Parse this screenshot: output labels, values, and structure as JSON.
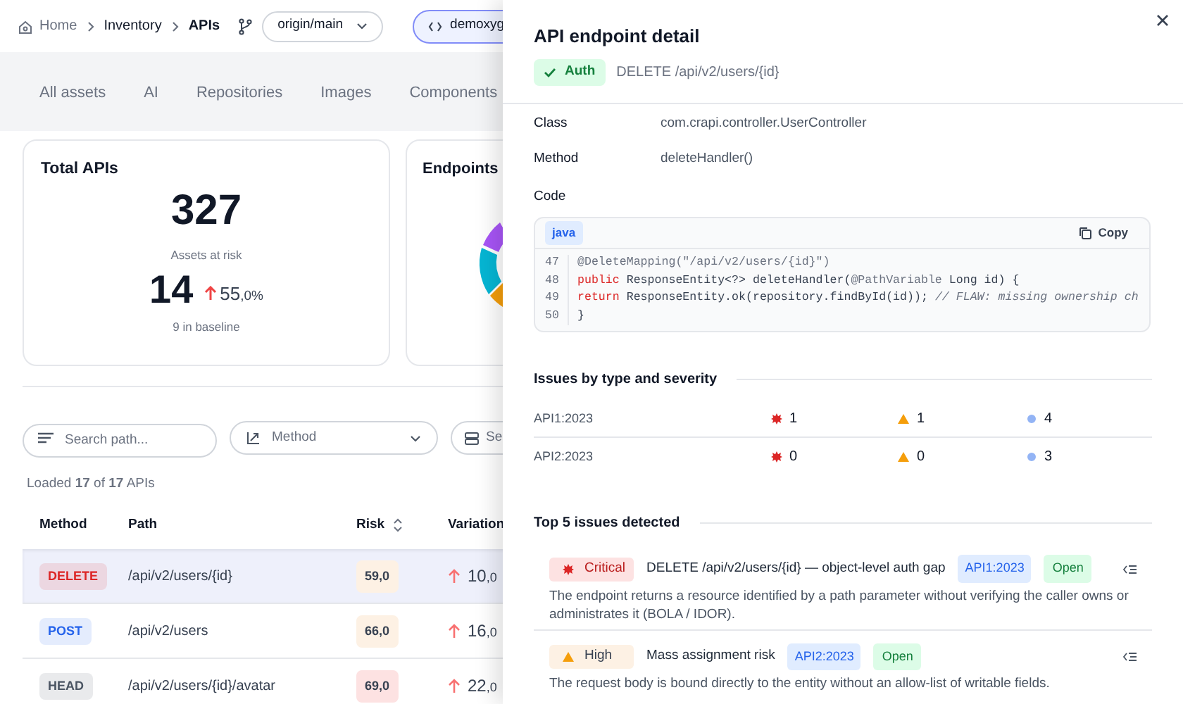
{
  "breadcrumb": [
    {
      "label": "Home",
      "kind": "home"
    },
    {
      "label": "Inventory",
      "kind": "link"
    },
    {
      "label": "APIs",
      "kind": "current"
    }
  ],
  "branch": {
    "label": "origin/main"
  },
  "repo_button": {
    "label": "demoxyg"
  },
  "tabs": [
    {
      "label": "All assets"
    },
    {
      "label": "AI"
    },
    {
      "label": "Repositories"
    },
    {
      "label": "Images"
    },
    {
      "label": "Components"
    }
  ],
  "total_card": {
    "title": "Total APIs",
    "total": "327",
    "risk_label": "Assets at risk",
    "risk_count": "14",
    "change": "55",
    "change_decimals": ",0%",
    "baseline": "9 in baseline"
  },
  "endpoints_card": {
    "title": "Endpoints"
  },
  "filters": {
    "search_placeholder": "Search path...",
    "method_label": "Method",
    "third_label": "Se"
  },
  "loaded": "Loaded **17** of **17** APIs",
  "table": {
    "columns": [
      "Method",
      "Path",
      "Risk",
      "Variation"
    ],
    "rows": [
      {
        "method": {
          "label": "DELETE",
          "color": "#dc2626"
        },
        "path": "/api/v2/users/{id}",
        "risk": {
          "value": "59,0",
          "color": "#fdf1e4"
        },
        "variation": "10",
        "variation_decimals": ",0",
        "selected": true
      },
      {
        "method": {
          "label": "POST",
          "color": "#2563eb"
        },
        "path": "/api/v2/users",
        "risk": {
          "value": "66,0",
          "color": "#fdf1e4"
        },
        "variation": "16",
        "variation_decimals": ",0",
        "selected": false
      },
      {
        "method": {
          "label": "HEAD",
          "color": "#4b5563"
        },
        "path": "/api/v2/users/{id}/avatar",
        "risk": {
          "value": "69,0",
          "color": "#fde2e2"
        },
        "variation": "22",
        "variation_decimals": ",0",
        "selected": false
      }
    ]
  },
  "detail": {
    "title": "API endpoint detail",
    "auth_badge": "Auth",
    "endpoint": "DELETE /api/v2/users/{id}",
    "fields": [
      {
        "label": "Class",
        "value": "com.crapi.controller.UserController"
      },
      {
        "label": "Method",
        "value": "deleteHandler()"
      }
    ],
    "code_label": "Code",
    "code": {
      "language": "java",
      "copy_label": "Copy",
      "lines": [
        {
          "number": "47",
          "tokens": [
            {
              "text": "@DeleteMapping(\"/api/v2/users/{id}\")",
              "kind": "annotation"
            }
          ]
        },
        {
          "number": "48",
          "tokens": [
            {
              "text": "public",
              "kind": "keyword"
            },
            {
              "text": " ResponseEntity<?> deleteHandler(",
              "kind": "plain"
            },
            {
              "text": "@PathVariable",
              "kind": "annotation"
            },
            {
              "text": " Long id) {",
              "kind": "plain"
            }
          ]
        },
        {
          "number": "49",
          "tokens": [
            {
              "text": "return",
              "kind": "keyword"
            },
            {
              "text": " ResponseEntity.ok(repository.findById(id)); ",
              "kind": "plain"
            },
            {
              "text": "// FLAW: missing ownership ch",
              "kind": "comment"
            }
          ]
        },
        {
          "number": "50",
          "tokens": [
            {
              "text": "}",
              "kind": "plain"
            }
          ]
        }
      ]
    },
    "issues_title": "Issues by type and severity",
    "issue_counts": [
      {
        "category": "API1:2023",
        "critical": "1",
        "high": "1",
        "low": "4"
      },
      {
        "category": "API2:2023",
        "critical": "0",
        "high": "0",
        "low": "3"
      }
    ],
    "top_title": "Top 5 issues detected",
    "top_issues": [
      {
        "severity": "Critical",
        "kind": "critical",
        "title": "DELETE /api/v2/users/{id} — object-level auth gap",
        "category": "API1:2023",
        "status": "Open",
        "description": "The endpoint returns a resource identified by a path parameter without verifying the caller owns or administrates it (BOLA / IDOR)."
      },
      {
        "severity": "High",
        "kind": "high",
        "title": "Mass assignment risk",
        "category": "API2:2023",
        "status": "Open",
        "description": "The request body is bound directly to the entity without an allow-list of writable fields."
      }
    ]
  }
}
